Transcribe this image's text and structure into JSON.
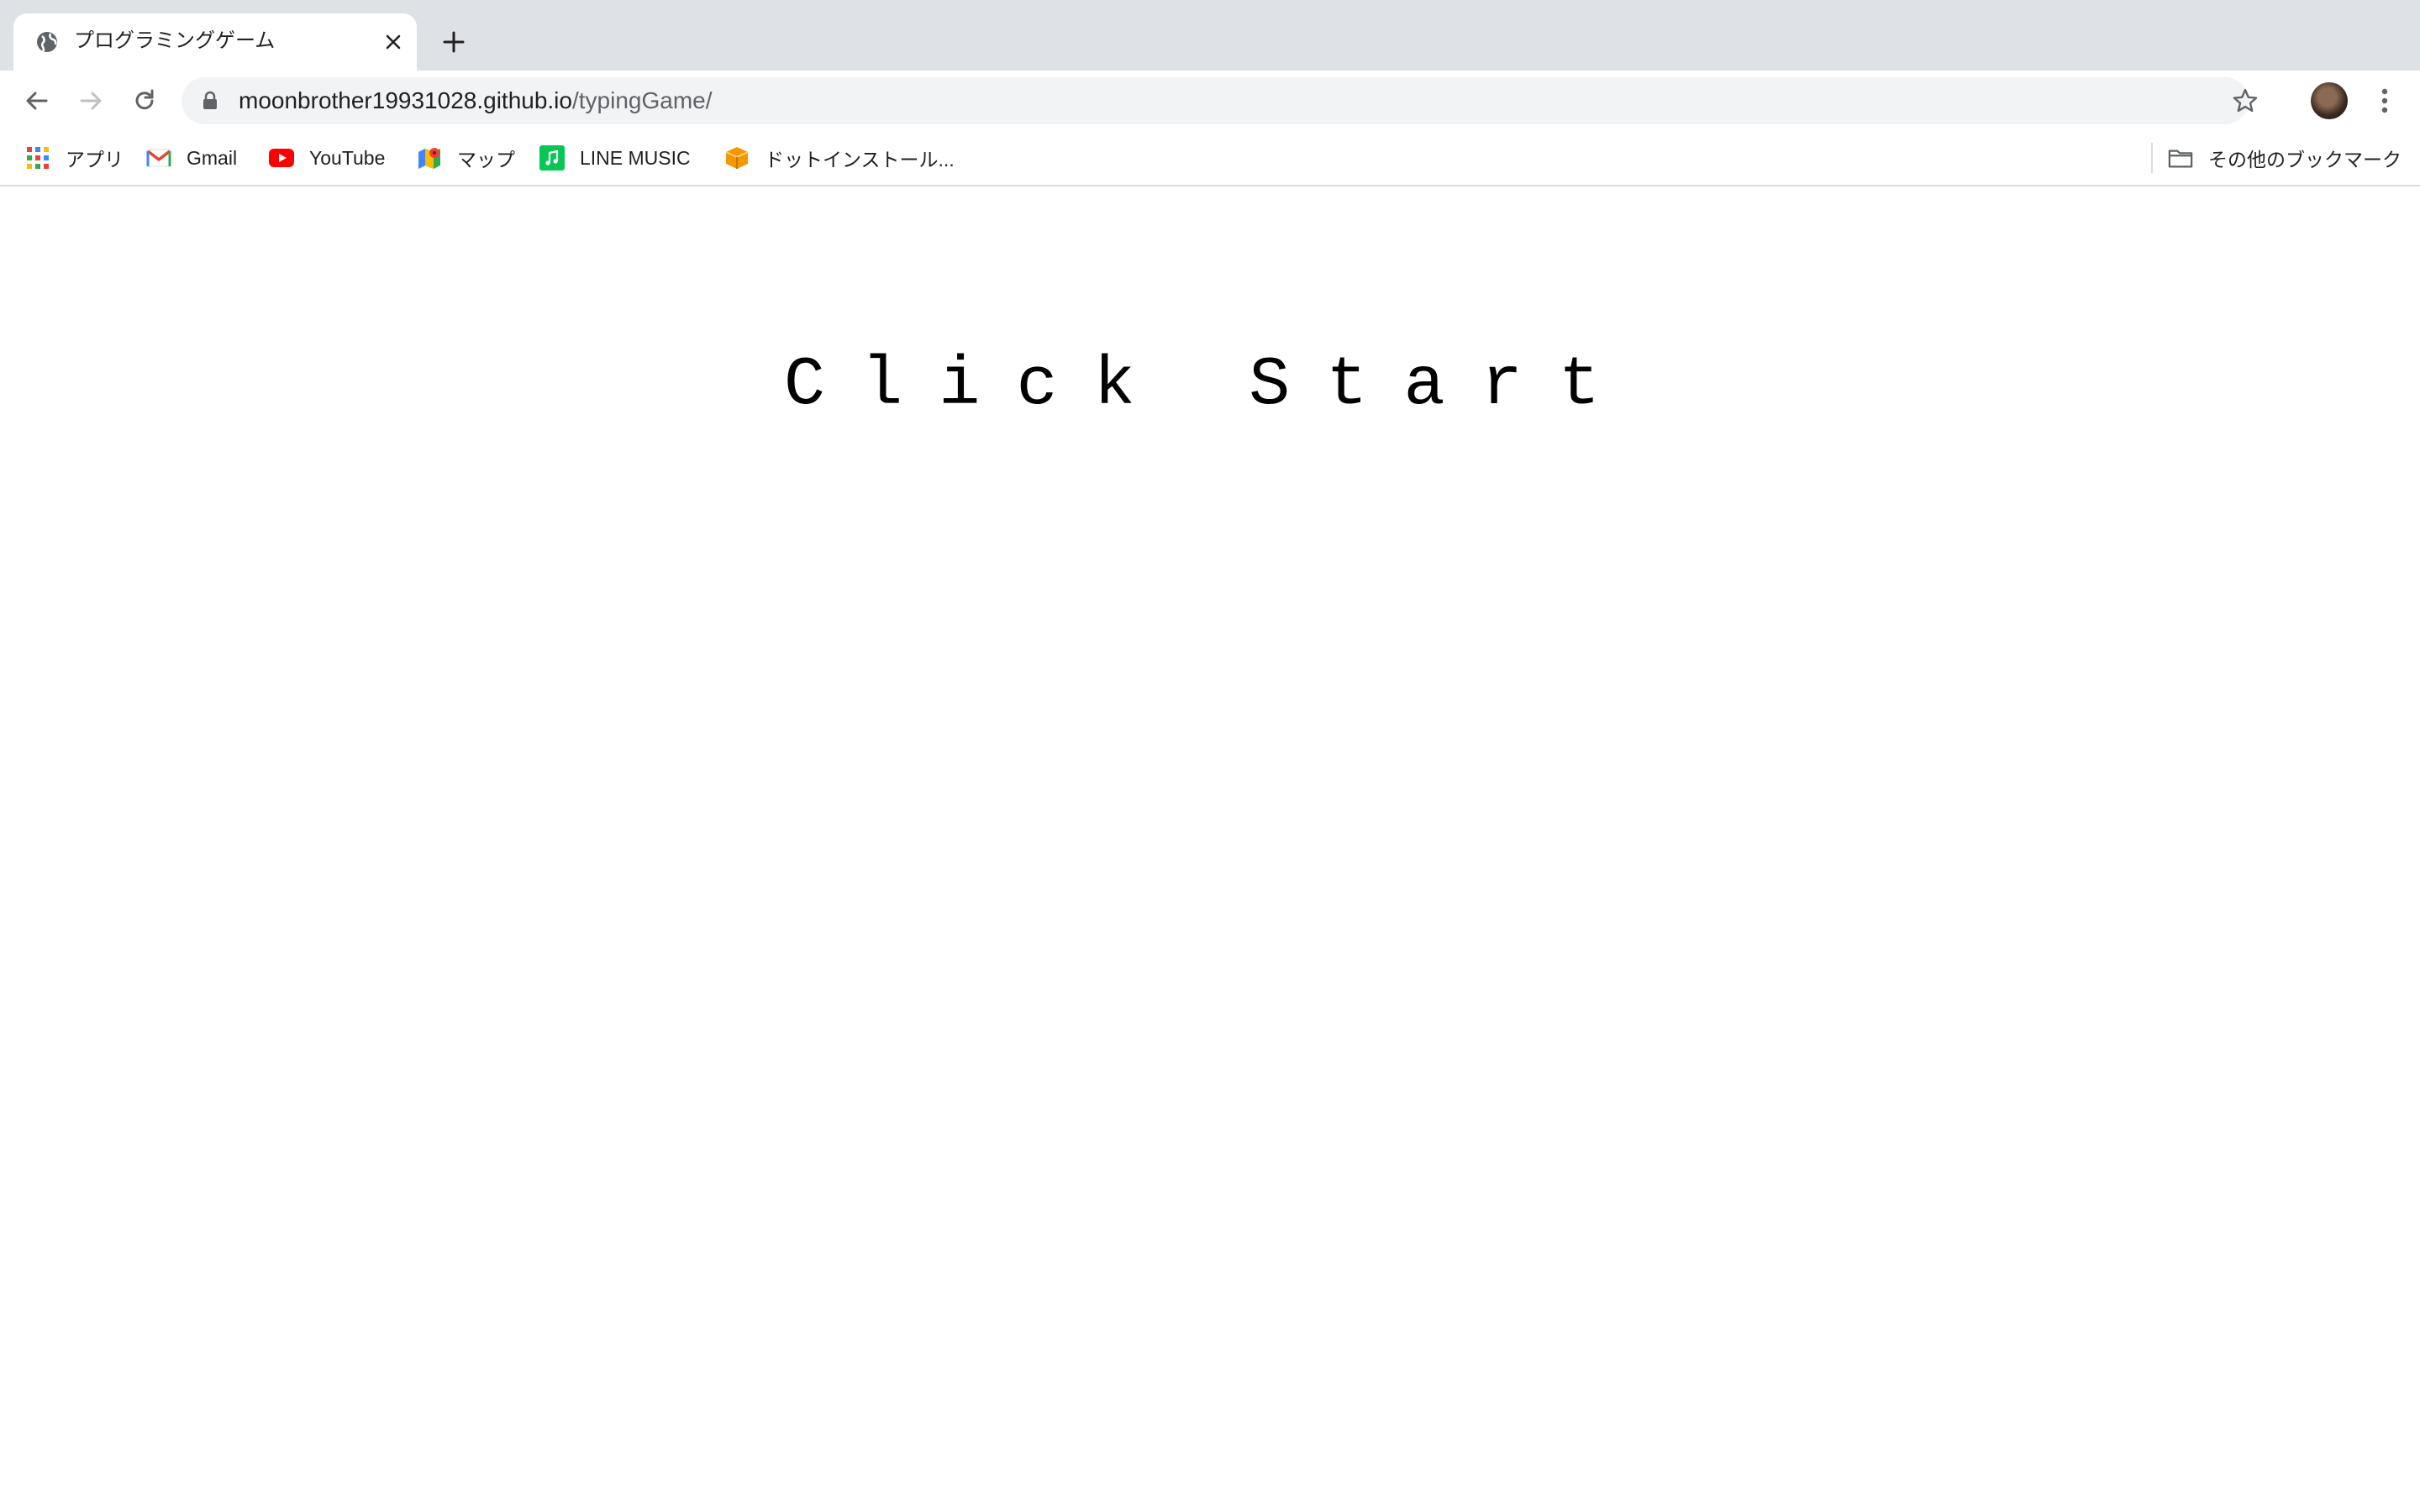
{
  "tab": {
    "title": "プログラミングゲーム"
  },
  "address_bar": {
    "host": "moonbrother19931028.github.io",
    "path": "/typingGame/"
  },
  "bookmarks": [
    {
      "label": "アプリ",
      "icon": "apps-grid-icon"
    },
    {
      "label": "Gmail",
      "icon": "gmail-icon"
    },
    {
      "label": "YouTube",
      "icon": "youtube-icon"
    },
    {
      "label": "マップ",
      "icon": "maps-icon"
    },
    {
      "label": "LINE MUSIC",
      "icon": "line-music-icon"
    },
    {
      "label": "ドットインストール...",
      "icon": "dotinstall-icon"
    }
  ],
  "other_bookmarks": {
    "label": "その他のブックマーク",
    "icon": "folder-icon"
  },
  "page": {
    "headline": "Click Start"
  },
  "colors": {
    "tabstrip": "#dee1e6",
    "omnibox": "#f1f3f4",
    "youtube_red": "#ff0000",
    "line_green": "#06c755",
    "dotinstall_orange": "#f39800"
  }
}
